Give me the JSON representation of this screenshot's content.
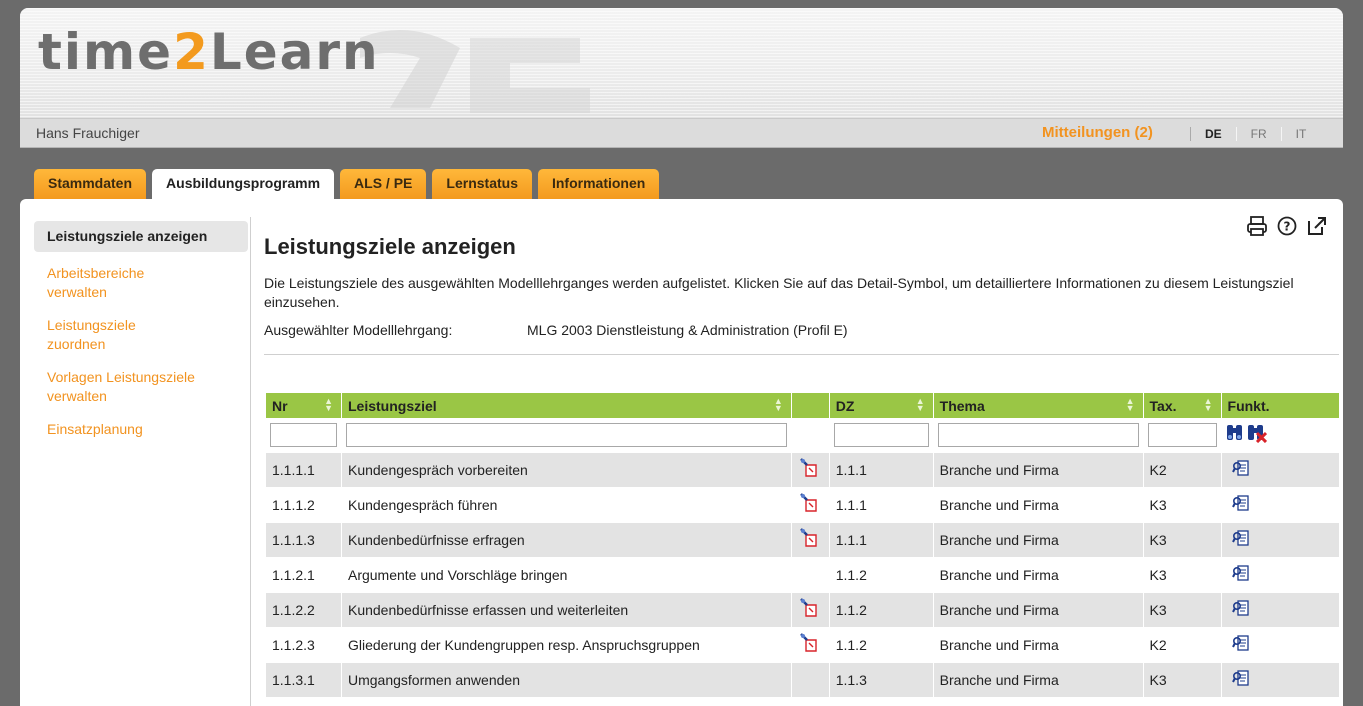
{
  "app": {
    "logo_part1": "time",
    "logo_part2": "2",
    "logo_part3": "Learn",
    "user_name": "Hans Frauchiger",
    "messages": "Mitteilungen (2)",
    "languages": [
      "DE",
      "FR",
      "IT"
    ]
  },
  "tabs": [
    "Stammdaten",
    "Ausbildungsprogramm",
    "ALS / PE",
    "Lernstatus",
    "Informationen"
  ],
  "sidenav": [
    "Leistungsziele anzeigen",
    "Arbeitsbereiche verwalten",
    "Leistungsziele zuordnen",
    "Vorlagen Leistungsziele verwalten",
    "Einsatzplanung"
  ],
  "main": {
    "title": "Leistungsziele anzeigen",
    "intro": "Die Leistungsziele des ausgewählten Modelllehrganges werden aufgelistet. Klicken Sie auf das Detail-Symbol, um detailliertere Informationen zu diesem Leistungsziel einzusehen.",
    "model_label": "Ausgewählter Modelllehrgang:",
    "model_value": "MLG 2003 Dienstleistung & Administration (Profil E)"
  },
  "table": {
    "headers": [
      "Nr",
      "Leistungsziel",
      "",
      "DZ",
      "Thema",
      "Tax.",
      "Funkt."
    ],
    "rows": [
      [
        "1.1.1.1",
        "Kundengespräch vorbereiten",
        true,
        "1.1.1",
        "Branche und Firma",
        "K2"
      ],
      [
        "1.1.1.2",
        "Kundengespräch führen",
        true,
        "1.1.1",
        "Branche und Firma",
        "K3"
      ],
      [
        "1.1.1.3",
        "Kundenbedürfnisse erfragen",
        true,
        "1.1.1",
        "Branche und Firma",
        "K3"
      ],
      [
        "1.1.2.1",
        "Argumente und Vorschläge bringen",
        false,
        "1.1.2",
        "Branche und Firma",
        "K3"
      ],
      [
        "1.1.2.2",
        "Kundenbedürfnisse erfassen und weiterleiten",
        true,
        "1.1.2",
        "Branche und Firma",
        "K3"
      ],
      [
        "1.1.2.3",
        "Gliederung der Kundengruppen resp. Anspruchsgruppen",
        true,
        "1.1.2",
        "Branche und Firma",
        "K2"
      ],
      [
        "1.1.3.1",
        "Umgangsformen anwenden",
        false,
        "1.1.3",
        "Branche und Firma",
        "K3"
      ]
    ]
  },
  "colors": {
    "accent": "#f29320",
    "header_green": "#9ac645",
    "row_gray": "#e3e3e3"
  },
  "icons": [
    "print-icon",
    "help-icon",
    "popout-icon",
    "search-icon",
    "clear-filter-icon",
    "note-icon",
    "detail-icon"
  ]
}
